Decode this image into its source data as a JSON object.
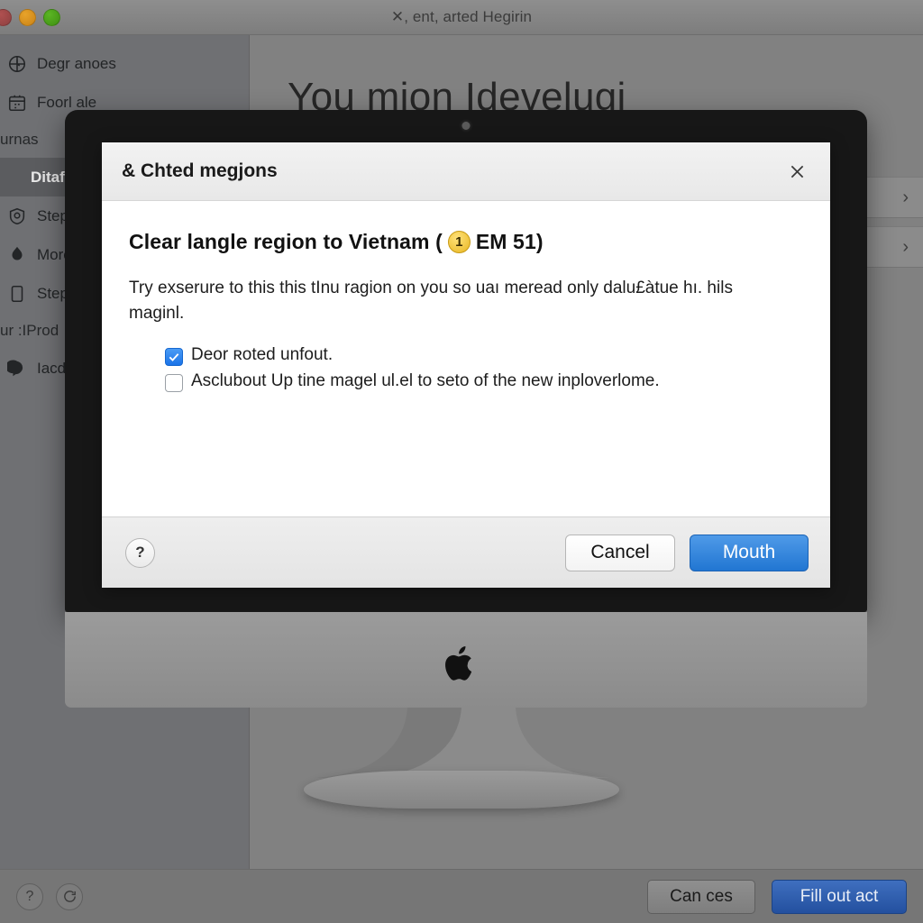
{
  "window": {
    "title": "✕, ent, arted Hegirin",
    "traffic_lights": [
      "red",
      "yellow",
      "green"
    ]
  },
  "sidebar": {
    "items": [
      {
        "label": "Degr anoes",
        "icon": "clock-icon",
        "type": "item",
        "selected": false
      },
      {
        "label": "Foorl ale",
        "icon": "calendar-icon",
        "type": "item",
        "selected": false
      },
      {
        "label": "urnas",
        "icon": "",
        "type": "section",
        "selected": false
      },
      {
        "label": "Ditaf",
        "icon": "",
        "type": "item",
        "selected": true
      },
      {
        "label": "Step",
        "icon": "shield-icon",
        "type": "item",
        "selected": false
      },
      {
        "label": "More",
        "icon": "flame-icon",
        "type": "item",
        "selected": false
      },
      {
        "label": "Step",
        "icon": "document-icon",
        "type": "item",
        "selected": false
      },
      {
        "label": "ur :IProd",
        "icon": "",
        "type": "section",
        "selected": false
      },
      {
        "label": "Iacd'",
        "icon": "chat-icon",
        "type": "item",
        "selected": false
      }
    ]
  },
  "main": {
    "heading": "You mion Idevelugi",
    "rows": [
      {
        "chevron": "›"
      },
      {
        "chevron": "›"
      }
    ]
  },
  "bottom_bar": {
    "help_icon": "question-mark-icon",
    "refresh_icon": "refresh-icon",
    "cancel_label": "Can ces",
    "primary_label": "Fill out act"
  },
  "dialog": {
    "title": "& Chted megjons",
    "close_icon": "close-icon",
    "heading_prefix": "Clear langle region to Vietnam (",
    "badge": "1",
    "heading_suffix": "EM 51)",
    "paragraph": "Try exserure to this this tInu ragion on you so uaı meread only dalu£àtue hı. hils maginl.",
    "checkboxes": [
      {
        "label": "Deor ʀoted unfout.",
        "checked": true
      },
      {
        "label": "Asclubout Up tine magel ul.el to seto of the new inploverlome.",
        "checked": false
      }
    ],
    "help_label": "?",
    "cancel_label": "Cancel",
    "primary_label": "Mouth"
  },
  "colors": {
    "accent_blue": "#2176d2",
    "badge_gold": "#e8b622",
    "checkbox_blue": "#1a73e8",
    "bottom_primary": "#23509f"
  }
}
